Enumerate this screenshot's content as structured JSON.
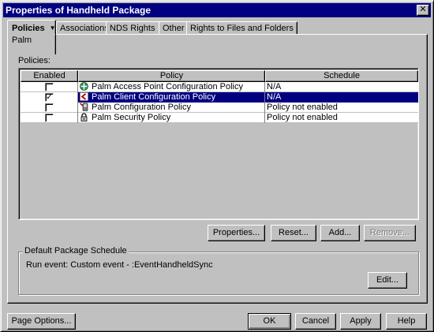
{
  "window": {
    "title": "Properties of Handheld Package",
    "close_glyph": "✕"
  },
  "tabs": {
    "active": {
      "label": "Policies",
      "sublabel": "Palm"
    },
    "others": [
      {
        "label": "Associations"
      },
      {
        "label": "NDS Rights"
      },
      {
        "label": "Other"
      },
      {
        "label": "Rights to Files and Folders"
      }
    ]
  },
  "policies": {
    "label": "Policies:",
    "columns": {
      "enabled": "Enabled",
      "policy": "Policy",
      "schedule": "Schedule"
    },
    "rows": [
      {
        "enabled": false,
        "policy": "Palm Access Point Configuration Policy",
        "schedule": "N/A",
        "icon": "access-point-icon"
      },
      {
        "enabled": true,
        "policy": "Palm Client Configuration Policy",
        "schedule": "N/A",
        "icon": "client-config-icon"
      },
      {
        "enabled": false,
        "policy": "Palm Configuration Policy",
        "schedule": "Policy not enabled",
        "icon": "palm-device-icon"
      },
      {
        "enabled": false,
        "policy": "Palm Security Policy",
        "schedule": "Policy not enabled",
        "icon": "lock-icon"
      }
    ],
    "selected_index": 1,
    "check_glyph": "✓"
  },
  "buttons": {
    "properties": "Properties...",
    "reset": "Reset...",
    "add": "Add...",
    "remove": "Remove..."
  },
  "schedule": {
    "group_title": "Default Package Schedule",
    "text": "Run event: Custom event - :EventHandheldSync",
    "edit": "Edit..."
  },
  "footer": {
    "page_options": "Page Options...",
    "ok": "OK",
    "cancel": "Cancel",
    "apply": "Apply",
    "help": "Help"
  }
}
